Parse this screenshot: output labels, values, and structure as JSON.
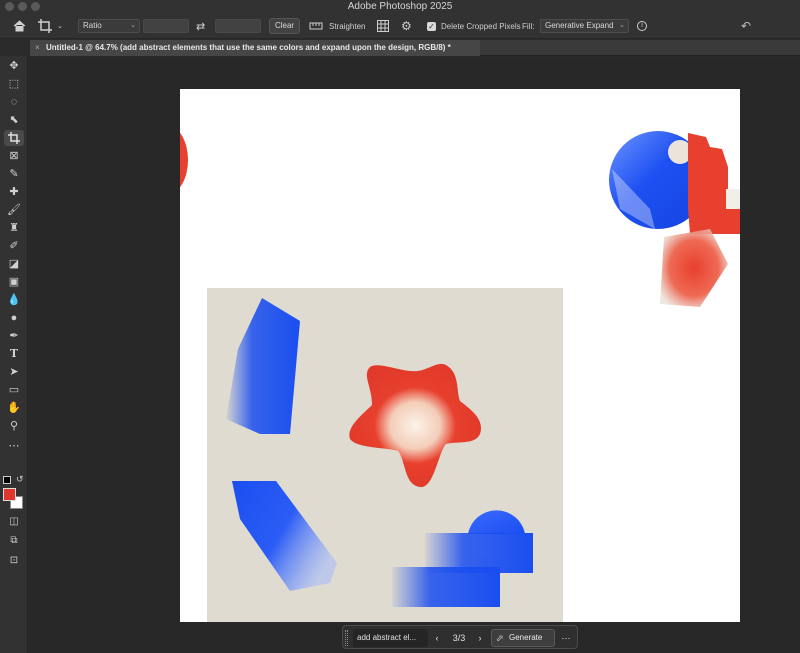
{
  "app": {
    "title": "Adobe Photoshop 2025"
  },
  "options_bar": {
    "ratio_label": "Ratio",
    "width_value": "",
    "height_value": "",
    "clear_label": "Clear",
    "straighten_label": "Straighten",
    "delete_cropped_label": "Delete Cropped Pixels",
    "delete_cropped_checked": true,
    "fill_label": "Fill:",
    "fill_value": "Generative Expand",
    "icons": [
      "home-icon",
      "crop-tool-icon",
      "swap-icon",
      "straighten-icon",
      "grid-overlay-icon",
      "settings-icon",
      "info-icon",
      "undo-icon"
    ]
  },
  "document": {
    "tab_title": "Untitled-1 @ 64.7% (add abstract elements that use the same colors and expand upon the design, RGB/8) *"
  },
  "tools": [
    "move-tool-icon",
    "marquee-tool-icon",
    "lasso-tool-icon",
    "object-select-tool-icon",
    "crop-tool-icon",
    "frame-tool-icon",
    "eyedropper-tool-icon",
    "healing-brush-tool-icon",
    "brush-tool-icon",
    "clone-stamp-tool-icon",
    "history-brush-tool-icon",
    "eraser-tool-icon",
    "gradient-tool-icon",
    "blur-tool-icon",
    "dodge-tool-icon",
    "pen-tool-icon",
    "type-tool-icon",
    "path-select-tool-icon",
    "rectangle-tool-icon",
    "hand-tool-icon",
    "zoom-tool-icon",
    "more-tools-icon"
  ],
  "colors": {
    "foreground": "#e0372c",
    "background": "#ffffff",
    "accent_blue": "#1a4ef0",
    "accent_red": "#e8402e",
    "panel_beige": "#dfdbd0"
  },
  "taskbar": {
    "prompt": "add abstract el...",
    "variation": "3/3",
    "generate_label": "Generate"
  }
}
